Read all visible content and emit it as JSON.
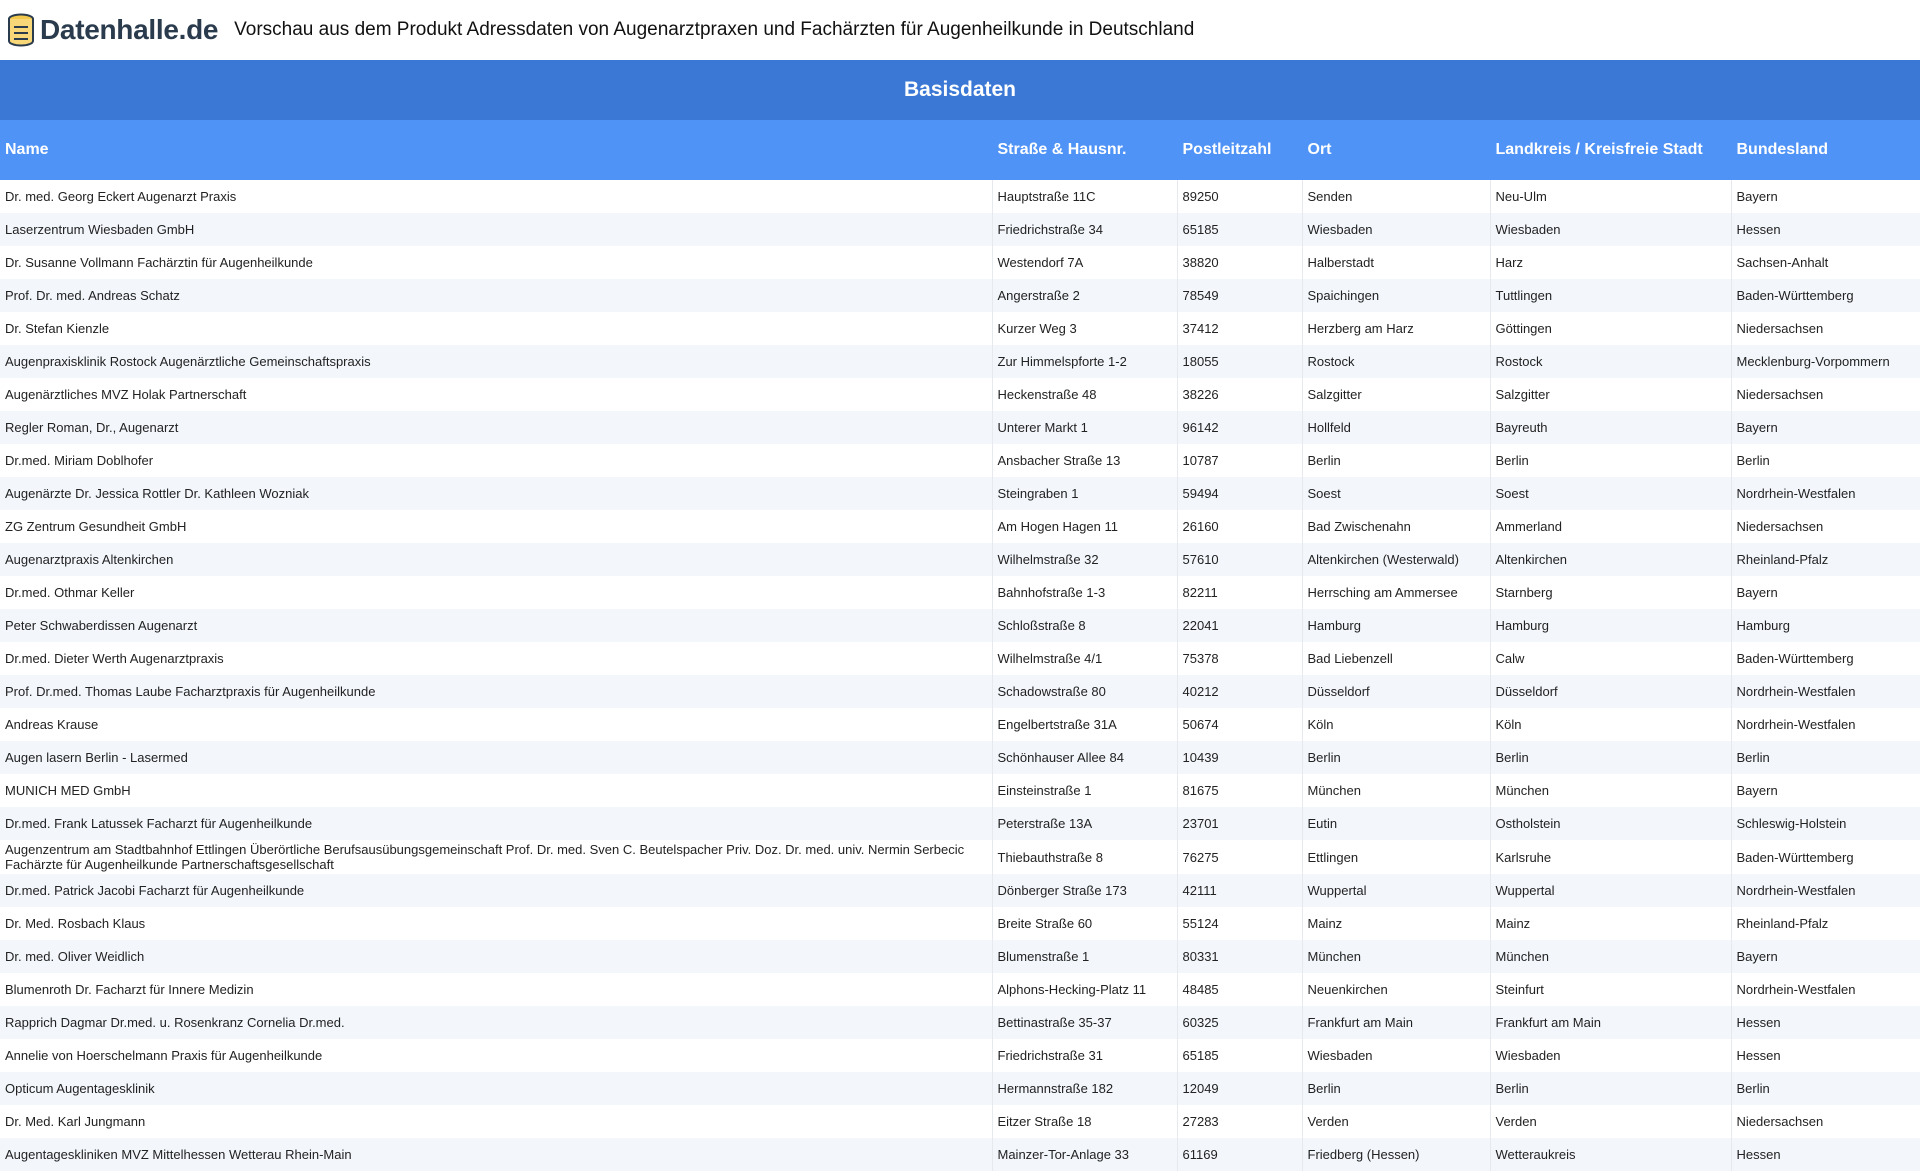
{
  "header": {
    "logo_text": "Datenhalle.de",
    "title": "Vorschau aus dem Produkt Adressdaten von Augenarztpraxen und Fachärzten für Augenheilkunde in Deutschland"
  },
  "table": {
    "group_title": "Basisdaten",
    "columns": [
      "Name",
      "Straße & Hausnr.",
      "Postleitzahl",
      "Ort",
      "Landkreis / Kreisfreie Stadt",
      "Bundesland"
    ],
    "rows": [
      [
        "Dr. med. Georg Eckert Augenarzt Praxis",
        "Hauptstraße 11C",
        "89250",
        "Senden",
        "Neu-Ulm",
        "Bayern"
      ],
      [
        "Laserzentrum Wiesbaden GmbH",
        "Friedrichstraße 34",
        "65185",
        "Wiesbaden",
        "Wiesbaden",
        "Hessen"
      ],
      [
        "Dr. Susanne Vollmann Fachärztin für Augenheilkunde",
        "Westendorf 7A",
        "38820",
        "Halberstadt",
        "Harz",
        "Sachsen-Anhalt"
      ],
      [
        "Prof. Dr. med. Andreas Schatz",
        "Angerstraße 2",
        "78549",
        "Spaichingen",
        "Tuttlingen",
        "Baden-Württemberg"
      ],
      [
        "Dr. Stefan Kienzle",
        "Kurzer Weg 3",
        "37412",
        "Herzberg am Harz",
        "Göttingen",
        "Niedersachsen"
      ],
      [
        "Augenpraxisklinik Rostock Augenärztliche Gemeinschaftspraxis",
        "Zur Himmelspforte 1-2",
        "18055",
        "Rostock",
        "Rostock",
        "Mecklenburg-Vorpommern"
      ],
      [
        "Augenärztliches MVZ Holak Partnerschaft",
        "Heckenstraße 48",
        "38226",
        "Salzgitter",
        "Salzgitter",
        "Niedersachsen"
      ],
      [
        "Regler Roman, Dr., Augenarzt",
        "Unterer Markt 1",
        "96142",
        "Hollfeld",
        "Bayreuth",
        "Bayern"
      ],
      [
        "Dr.med. Miriam Doblhofer",
        "Ansbacher Straße 13",
        "10787",
        "Berlin",
        "Berlin",
        "Berlin"
      ],
      [
        "Augenärzte Dr. Jessica Rottler Dr. Kathleen Wozniak",
        "Steingraben 1",
        "59494",
        "Soest",
        "Soest",
        "Nordrhein-Westfalen"
      ],
      [
        "ZG Zentrum Gesundheit GmbH",
        "Am Hogen Hagen 11",
        "26160",
        "Bad Zwischenahn",
        "Ammerland",
        "Niedersachsen"
      ],
      [
        "Augenarztpraxis Altenkirchen",
        "Wilhelmstraße 32",
        "57610",
        "Altenkirchen (Westerwald)",
        "Altenkirchen",
        "Rheinland-Pfalz"
      ],
      [
        "Dr.med. Othmar Keller",
        "Bahnhofstraße 1-3",
        "82211",
        "Herrsching am Ammersee",
        "Starnberg",
        "Bayern"
      ],
      [
        "Peter Schwaberdissen Augenarzt",
        "Schloßstraße 8",
        "22041",
        "Hamburg",
        "Hamburg",
        "Hamburg"
      ],
      [
        "Dr.med. Dieter Werth Augenarztpraxis",
        "Wilhelmstraße 4/1",
        "75378",
        "Bad Liebenzell",
        "Calw",
        "Baden-Württemberg"
      ],
      [
        "Prof. Dr.med. Thomas Laube Facharztpraxis für Augenheilkunde",
        "Schadowstraße 80",
        "40212",
        "Düsseldorf",
        "Düsseldorf",
        "Nordrhein-Westfalen"
      ],
      [
        "Andreas Krause",
        "Engelbertstraße 31A",
        "50674",
        "Köln",
        "Köln",
        "Nordrhein-Westfalen"
      ],
      [
        "Augen lasern Berlin - Lasermed",
        "Schönhauser Allee 84",
        "10439",
        "Berlin",
        "Berlin",
        "Berlin"
      ],
      [
        "MUNICH MED GmbH",
        "Einsteinstraße 1",
        "81675",
        "München",
        "München",
        "Bayern"
      ],
      [
        "Dr.med. Frank Latussek Facharzt für Augenheilkunde",
        "Peterstraße 13A",
        "23701",
        "Eutin",
        "Ostholstein",
        "Schleswig-Holstein"
      ],
      [
        "Augenzentrum am Stadtbahnhof Ettlingen Überörtliche Berufsausübungsgemeinschaft Prof. Dr. med. Sven C. Beutelspacher Priv. Doz. Dr. med. univ. Nermin Serbecic Fachärzte für Augenheilkunde Partnerschaftsgesellschaft",
        "Thiebauthstraße 8",
        "76275",
        "Ettlingen",
        "Karlsruhe",
        "Baden-Württemberg"
      ],
      [
        "Dr.med. Patrick Jacobi Facharzt für Augenheilkunde",
        "Dönberger Straße 173",
        "42111",
        "Wuppertal",
        "Wuppertal",
        "Nordrhein-Westfalen"
      ],
      [
        "Dr. Med. Rosbach Klaus",
        "Breite Straße 60",
        "55124",
        "Mainz",
        "Mainz",
        "Rheinland-Pfalz"
      ],
      [
        "Dr. med. Oliver Weidlich",
        "Blumenstraße 1",
        "80331",
        "München",
        "München",
        "Bayern"
      ],
      [
        "Blumenroth Dr. Facharzt für Innere Medizin",
        "Alphons-Hecking-Platz 11",
        "48485",
        "Neuenkirchen",
        "Steinfurt",
        "Nordrhein-Westfalen"
      ],
      [
        "Rapprich Dagmar Dr.med. u. Rosenkranz Cornelia Dr.med.",
        "Bettinastraße 35-37",
        "60325",
        "Frankfurt am Main",
        "Frankfurt am Main",
        "Hessen"
      ],
      [
        "Annelie von Hoerschelmann Praxis für Augenheilkunde",
        "Friedrichstraße 31",
        "65185",
        "Wiesbaden",
        "Wiesbaden",
        "Hessen"
      ],
      [
        "Opticum Augentagesklinik",
        "Hermannstraße 182",
        "12049",
        "Berlin",
        "Berlin",
        "Berlin"
      ],
      [
        "Dr. Med. Karl Jungmann",
        "Eitzer Straße 18",
        "27283",
        "Verden",
        "Verden",
        "Niedersachsen"
      ],
      [
        "Augentageskliniken MVZ Mittelhessen Wetterau Rhein-Main",
        "Mainzer-Tor-Anlage 33",
        "61169",
        "Friedberg (Hessen)",
        "Wetteraukreis",
        "Hessen"
      ]
    ]
  }
}
